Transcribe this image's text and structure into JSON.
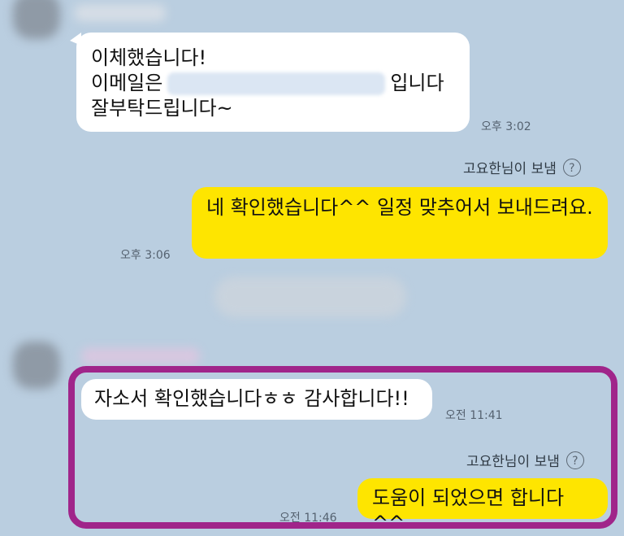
{
  "messages": {
    "m1": {
      "line1": "이체했습니다!",
      "line2_prefix": "이메일은",
      "line2_suffix": "입니다",
      "line3": "잘부탁드립니다~",
      "time": "오후 3:02"
    },
    "m2": {
      "sender_label": "고요한님이 보냄",
      "text": "네 확인했습니다^^ 일정 맞추어서 보내드려요.",
      "time": "오후 3:06"
    },
    "m3": {
      "text": "자소서 확인했습니다ㅎㅎ 감사합니다!!",
      "time": "오전 11:41"
    },
    "m4": {
      "sender_label": "고요한님이 보냄",
      "text": "도움이 되었으면 합니다^^",
      "time": "오전 11:46"
    }
  },
  "icons": {
    "help": "?"
  },
  "colors": {
    "background": "#bacee0",
    "my_bubble": "#fee500",
    "their_bubble": "#ffffff",
    "highlight": "#a0258a"
  }
}
